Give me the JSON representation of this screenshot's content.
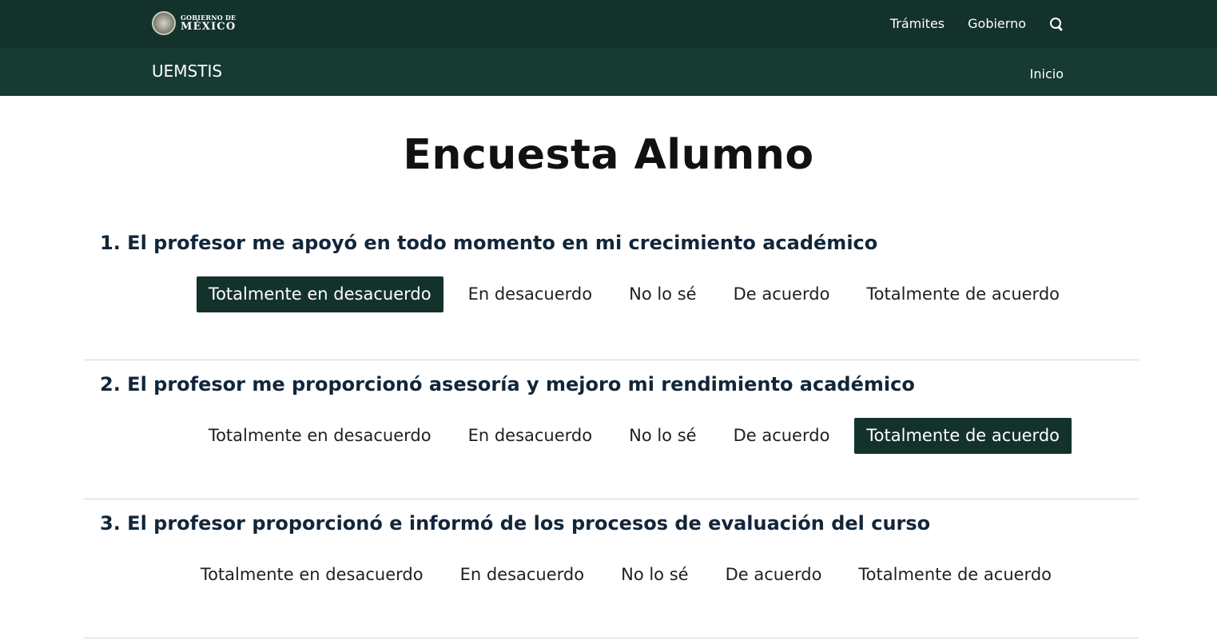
{
  "header": {
    "brand_small": "GOBIERNO DE",
    "brand_big": "MÉXICO",
    "nav": [
      "Trámites",
      "Gobierno"
    ],
    "icon": "search-icon"
  },
  "subheader": {
    "site_name": "UEMSTIS",
    "nav": [
      "Inicio"
    ]
  },
  "page": {
    "title": "Encuesta Alumno"
  },
  "questions": [
    {
      "title": "1. El profesor me apoyó en todo momento en mi crecimiento académico",
      "options": [
        "Totalmente en desacuerdo",
        "En desacuerdo",
        "No lo sé",
        "De acuerdo",
        "Totalmente de acuerdo"
      ],
      "selected": "Totalmente en desacuerdo"
    },
    {
      "title": "2. El profesor me proporcionó asesoría y mejoro mi rendimiento académico",
      "options": [
        "Totalmente en desacuerdo",
        "En desacuerdo",
        "No lo sé",
        "De acuerdo",
        "Totalmente de acuerdo"
      ],
      "selected": "Totalmente de acuerdo"
    },
    {
      "title": "3. El profesor proporcionó e informó de los procesos de evaluación del curso",
      "options": [
        "Totalmente en desacuerdo",
        "En desacuerdo",
        "No lo sé",
        "De acuerdo",
        "Totalmente de acuerdo"
      ],
      "selected": ""
    }
  ],
  "colors": {
    "primary": "#13322b",
    "secondary": "#173a32",
    "question_text": "#12263a"
  }
}
